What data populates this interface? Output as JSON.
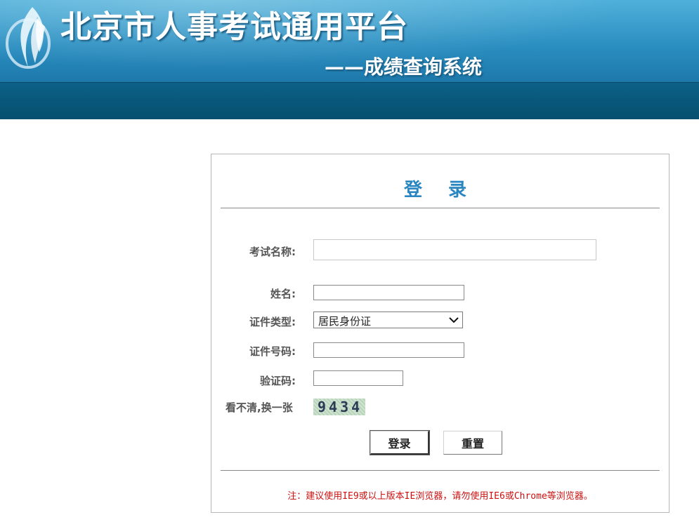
{
  "header": {
    "site_title": "北京市人事考试通用平台",
    "site_subtitle": "——成绩查询系统",
    "colors": {
      "banner": "#2b8fc1",
      "nav_bar": "#05506f"
    }
  },
  "login": {
    "title": "登 录",
    "exam_name_label": "考试名称:",
    "exam_name_value": "",
    "name_label": "姓名:",
    "name_value": "",
    "id_type_label": "证件类型:",
    "id_type_value": "居民身份证",
    "id_number_label": "证件号码:",
    "id_number_value": "",
    "captcha_label": "验证码:",
    "captcha_value": "",
    "captcha_refresh_label": "看不清,换一张",
    "captcha_image_text": "9434",
    "login_button": "登录",
    "reset_button": "重置",
    "notice": "注：建议使用IE9或以上版本IE浏览器，请勿使用IE6或Chrome等浏览器。",
    "colors": {
      "title": "#2a86c0",
      "notice": "#cc1111"
    }
  }
}
